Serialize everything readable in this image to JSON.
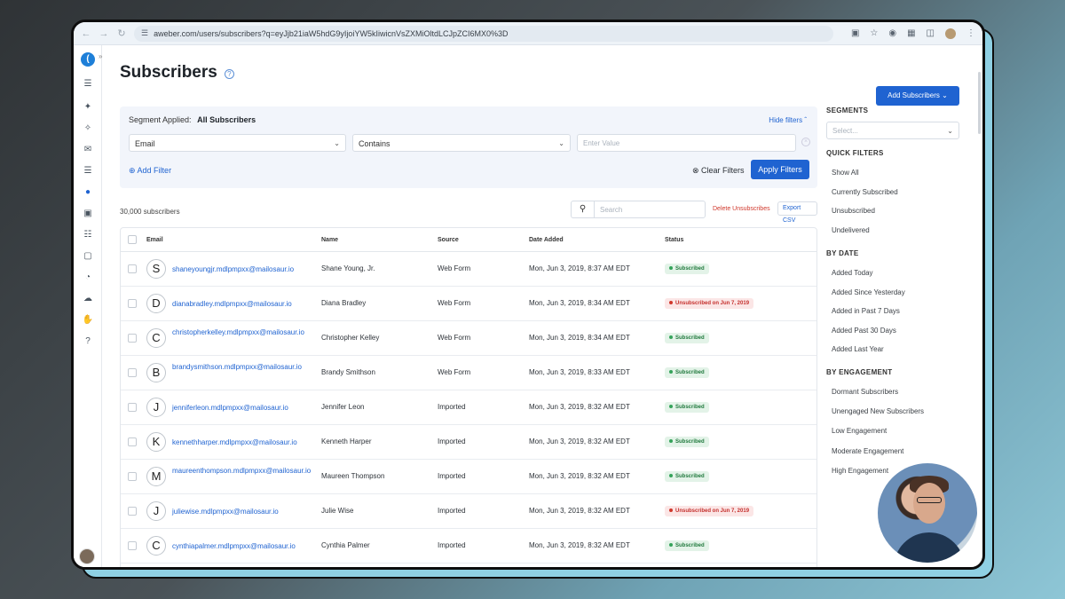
{
  "browser": {
    "url": "aweber.com/users/subscribers?q=eyJjb21iaW5hdG9yIjoiYW5kIiwicnVsZXMiOltdLCJpZCI6MX0%3D"
  },
  "page": {
    "title": "Subscribers",
    "add_subscribers_label": "Add Subscribers"
  },
  "filters": {
    "segment_applied_label": "Segment Applied:",
    "segment_applied_value": "All Subscribers",
    "hide_filters_label": "Hide filters",
    "field_select": "Email",
    "operator_select": "Contains",
    "value_placeholder": "Enter Value",
    "add_filter_label": "Add Filter",
    "clear_filters_label": "Clear Filters",
    "apply_filters_label": "Apply Filters"
  },
  "toolbar": {
    "count": "30,000 subscribers",
    "search_placeholder": "Search",
    "delete_unsubscribes_label": "Delete Unsubscribes",
    "export_csv_label": "Export CSV"
  },
  "table": {
    "headers": {
      "email": "Email",
      "name": "Name",
      "source": "Source",
      "date_added": "Date Added",
      "status": "Status"
    },
    "rows": [
      {
        "initial": "S",
        "email": "shaneyoungjr.mdlpmpxx@mailosaur.io",
        "name": "Shane Young, Jr.",
        "source": "Web Form",
        "date": "Mon, Jun 3, 2019, 8:37 AM EDT",
        "status": "Subscribed"
      },
      {
        "initial": "D",
        "email": "dianabradley.mdlpmpxx@mailosaur.io",
        "name": "Diana Bradley",
        "source": "Web Form",
        "date": "Mon, Jun 3, 2019, 8:34 AM EDT",
        "status": "Unsubscribed on Jun 7, 2019"
      },
      {
        "initial": "C",
        "email": "christopherkelley.mdlpmpxx@mailosaur.io",
        "name": "Christopher Kelley",
        "source": "Web Form",
        "date": "Mon, Jun 3, 2019, 8:34 AM EDT",
        "status": "Subscribed"
      },
      {
        "initial": "B",
        "email": "brandysmithson.mdlpmpxx@mailosaur.io",
        "name": "Brandy Smithson",
        "source": "Web Form",
        "date": "Mon, Jun 3, 2019, 8:33 AM EDT",
        "status": "Subscribed"
      },
      {
        "initial": "J",
        "email": "jenniferleon.mdlpmpxx@mailosaur.io",
        "name": "Jennifer Leon",
        "source": "Imported",
        "date": "Mon, Jun 3, 2019, 8:32 AM EDT",
        "status": "Subscribed"
      },
      {
        "initial": "K",
        "email": "kennethharper.mdlpmpxx@mailosaur.io",
        "name": "Kenneth Harper",
        "source": "Imported",
        "date": "Mon, Jun 3, 2019, 8:32 AM EDT",
        "status": "Subscribed"
      },
      {
        "initial": "M",
        "email": "maureenthompson.mdlpmpxx@mailosaur.io",
        "name": "Maureen Thompson",
        "source": "Imported",
        "date": "Mon, Jun 3, 2019, 8:32 AM EDT",
        "status": "Subscribed"
      },
      {
        "initial": "J",
        "email": "juliewise.mdlpmpxx@mailosaur.io",
        "name": "Julie Wise",
        "source": "Imported",
        "date": "Mon, Jun 3, 2019, 8:32 AM EDT",
        "status": "Unsubscribed on Jun 7, 2019"
      },
      {
        "initial": "C",
        "email": "cynthiapalmer.mdlpmpxx@mailosaur.io",
        "name": "Cynthia Palmer",
        "source": "Imported",
        "date": "Mon, Jun 3, 2019, 8:32 AM EDT",
        "status": "Subscribed"
      }
    ]
  },
  "sidebar": {
    "segments_heading": "SEGMENTS",
    "segments_placeholder": "Select...",
    "quick_filters_heading": "QUICK FILTERS",
    "quick_filters": [
      "Show All",
      "Currently Subscribed",
      "Unsubscribed",
      "Undelivered"
    ],
    "by_date_heading": "BY DATE",
    "by_date": [
      "Added Today",
      "Added Since Yesterday",
      "Added in Past 7 Days",
      "Added Past 30 Days",
      "Added Last Year"
    ],
    "by_engagement_heading": "BY ENGAGEMENT",
    "by_engagement": [
      "Dormant Subscribers",
      "Unengaged New Subscribers",
      "Low Engagement",
      "Moderate Engagement",
      "High Engagement"
    ]
  },
  "colors": {
    "accent": "#1f63d1",
    "subscribed": "#217a3e",
    "unsubscribed": "#c5302d"
  }
}
